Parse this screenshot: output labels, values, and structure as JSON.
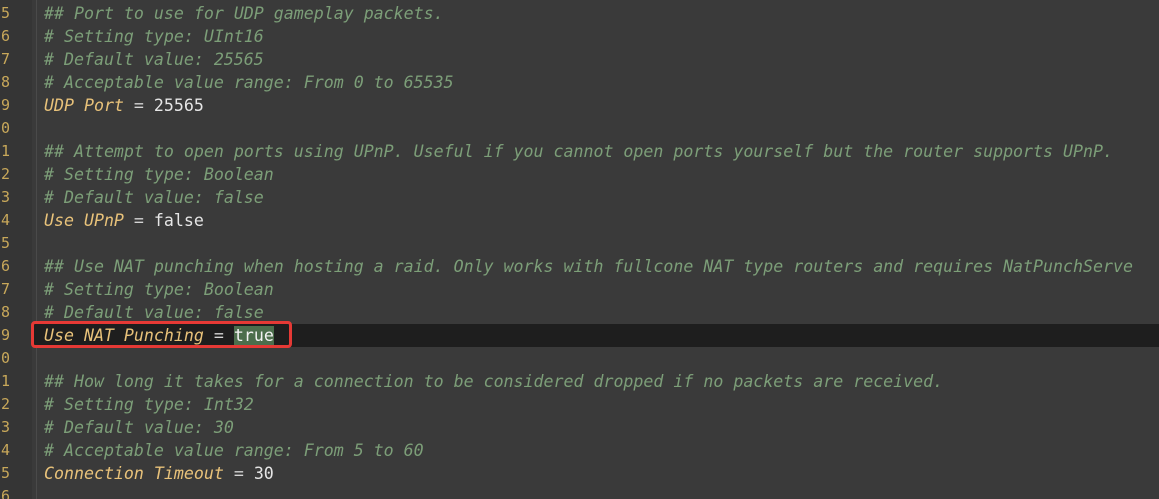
{
  "gutter": {
    "line_digits": [
      "5",
      "6",
      "7",
      "8",
      "9",
      "0",
      "1",
      "2",
      "3",
      "4",
      "5",
      "6",
      "7",
      "8",
      "9",
      "0",
      "1",
      "2",
      "3",
      "4",
      "5",
      "6"
    ]
  },
  "lines": [
    {
      "type": "comment",
      "text": "## Port to use for UDP gameplay packets."
    },
    {
      "type": "comment",
      "text": "# Setting type: UInt16"
    },
    {
      "type": "comment",
      "text": "# Default value: 25565"
    },
    {
      "type": "comment",
      "text": "# Acceptable value range: From 0 to 65535"
    },
    {
      "type": "setting",
      "key": "UDP Port",
      "op": " = ",
      "value": "25565"
    },
    {
      "type": "blank"
    },
    {
      "type": "comment",
      "text": "## Attempt to open ports using UPnP. Useful if you cannot open ports yourself but the router supports UPnP."
    },
    {
      "type": "comment",
      "text": "# Setting type: Boolean"
    },
    {
      "type": "comment",
      "text": "# Default value: false"
    },
    {
      "type": "setting",
      "key": "Use UPnP",
      "op": " = ",
      "value": "false"
    },
    {
      "type": "blank"
    },
    {
      "type": "comment",
      "text": "## Use NAT punching when hosting a raid. Only works with fullcone NAT type routers and requires NatPunchServe"
    },
    {
      "type": "comment",
      "text": "# Setting type: Boolean"
    },
    {
      "type": "comment",
      "text": "# Default value: false"
    },
    {
      "type": "setting",
      "key": "Use NAT Punching",
      "op": " = ",
      "value": "true",
      "current": true,
      "selected": true
    },
    {
      "type": "blank"
    },
    {
      "type": "comment",
      "text": "## How long it takes for a connection to be considered dropped if no packets are received."
    },
    {
      "type": "comment",
      "text": "# Setting type: Int32"
    },
    {
      "type": "comment",
      "text": "# Default value: 30"
    },
    {
      "type": "comment",
      "text": "# Acceptable value range: From 5 to 60"
    },
    {
      "type": "setting",
      "key": "Connection Timeout",
      "op": " = ",
      "value": "30"
    },
    {
      "type": "blank"
    }
  ],
  "colors": {
    "background": "#3a3a3a",
    "comment": "#7c9e78",
    "key": "#e8c27a",
    "value": "#e6e6e6",
    "current_line": "#1e1e1e",
    "selection": "#4c6e4c",
    "highlight_box": "#e53935"
  }
}
